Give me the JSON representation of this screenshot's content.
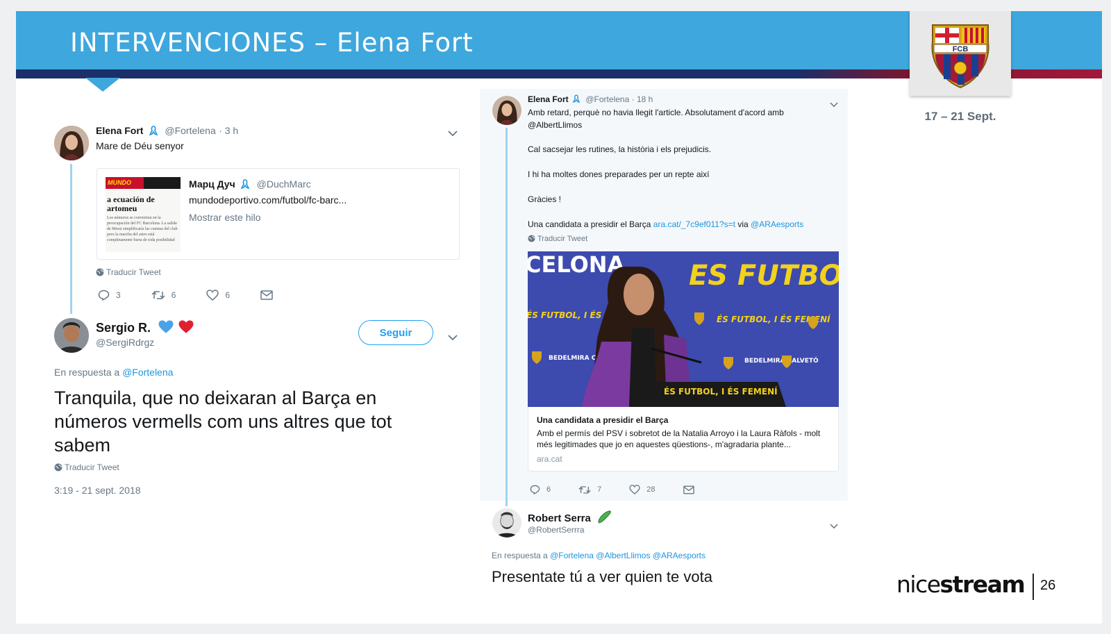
{
  "slide": {
    "title": "INTERVENCIONES – Elena Fort",
    "date_range": "17 – 21 Sept.",
    "page_number": "26",
    "brand_light": "nice",
    "brand_bold": "stream",
    "logo_text": "FCB"
  },
  "tweet_left": {
    "name": "Elena Fort",
    "handle": "@Fortelena",
    "time": "· 3 h",
    "text": "Mare de Déu senyor",
    "quoted": {
      "paper_logo": "MUNDO",
      "paper_logo_sub": "DEPORTIVO",
      "paper_headline": "a ecuación de artomeu",
      "paper_body": "Los números se convierten en la preocupación del FC Barcelona. La salida de Messi simplificaría las cuentas del club pero la marcha del astro está completamente fuera de toda posibilidad",
      "name": "Марц Дуч",
      "handle": "@DuchMarc",
      "url": "mundodeportivo.com/futbol/fc-barc...",
      "show_thread": "Mostrar este hilo"
    },
    "translate": "Traducir Tweet",
    "replies": "3",
    "retweets": "6",
    "likes": "6"
  },
  "reply_left": {
    "name": "Sergio R.",
    "emoji": "💙❤️",
    "handle": "@SergiRdrgz",
    "follow_label": "Seguir",
    "in_reply_prefix": "En respuesta a",
    "in_reply_to": "@Fortelena",
    "text": "Tranquila, que no deixaran al Barça en números vermells com uns altres que tot sabem",
    "translate": "Traducir Tweet",
    "timestamp": "3:19 - 21 sept. 2018"
  },
  "tweet_right": {
    "name": "Elena Fort",
    "handle": "@Fortelena",
    "time": "· 18 h",
    "line1": "Amb retard, perquè no havia llegit l'article. Absolutament d'acord amb",
    "mention": "@AlbertLlimos",
    "line2": "Cal sacsejar les rutines, la història i els prejudicis.",
    "line3": "I hi ha moltes dones preparades per un repte així",
    "line4": "Gràcies !",
    "line5_prefix": "Una candidata a presidir el Barça",
    "line5_link": "ara.cat/_7c9ef011?s=t",
    "line5_via": "via",
    "line5_mention": "@ARAesports",
    "translate": "Traducir Tweet",
    "photo_text_top_left": "CELONA",
    "photo_text_top_right": "ES FUTBOL,",
    "photo_podium": "ÉS FUTBOL, I ÉS FEMENÍ",
    "photo_banner": "ÉS FUTBOL, I ÉS FEMENÍ",
    "photo_sponsor": "BEDELMIRA CALVETÓ",
    "card_title": "Una candidata a presidir el Barça",
    "card_desc": "Amb el permís del PSV i sobretot de la Natalia Arroyo i la Laura Ràfols - molt més legitimades que jo en aquestes qüestions-, m'agradaria plante...",
    "card_domain": "ara.cat",
    "replies": "6",
    "retweets": "7",
    "likes": "28"
  },
  "reply_right": {
    "name": "Robert Serra",
    "handle": "@RobertSerrra",
    "in_reply_prefix": "En respuesta a",
    "in_reply_to": "@Fortelena @AlbertLlimos @ARAesports",
    "text": "Presentate tú a ver quien te vota"
  },
  "icons": [
    "reply-icon",
    "retweet-icon",
    "like-icon",
    "message-icon",
    "globe-icon",
    "chevron-down-icon",
    "ribbon-icon"
  ],
  "colors": {
    "band_blue": "#3ea7dd",
    "stripe_navy": "#1b2f6a",
    "stripe_garnet": "#a3183a",
    "twitter_blue": "#1da1f2"
  }
}
